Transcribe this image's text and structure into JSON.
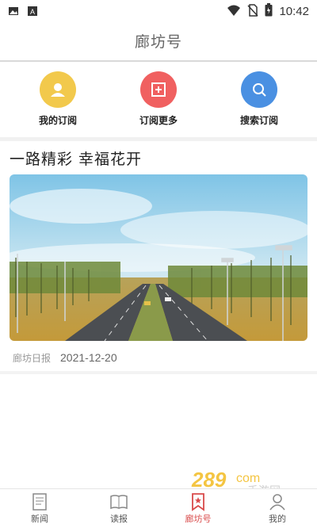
{
  "status_bar": {
    "time": "10:42",
    "left_icons": [
      "image-icon",
      "font-icon"
    ],
    "right_icons": [
      "wifi-icon",
      "no-sim-icon",
      "battery-icon"
    ]
  },
  "header": {
    "title": "廊坊号"
  },
  "quick_actions": [
    {
      "label": "我的订阅",
      "icon": "user-icon",
      "color": "#f2c94c"
    },
    {
      "label": "订阅更多",
      "icon": "add-subscription-icon",
      "color": "#f06060"
    },
    {
      "label": "搜索订阅",
      "icon": "search-icon",
      "color": "#4a90e2"
    }
  ],
  "article": {
    "title": "一路精彩  幸福花开",
    "source": "廊坊日报",
    "date": "2021-12-20",
    "image": "highway-with-streetlights-photo"
  },
  "bottom_nav": [
    {
      "label": "新闻",
      "icon": "news-icon",
      "active": false
    },
    {
      "label": "读报",
      "icon": "newspaper-book-icon",
      "active": false
    },
    {
      "label": "廊坊号",
      "icon": "bookmark-star-icon",
      "active": true
    },
    {
      "label": "我的",
      "icon": "profile-icon",
      "active": false
    }
  ],
  "watermark": {
    "brand": "289",
    "suffix": "com",
    "subtitle": "手游网"
  },
  "colors": {
    "active_tab": "#d94a4a",
    "divider": "#f1f1f1"
  }
}
